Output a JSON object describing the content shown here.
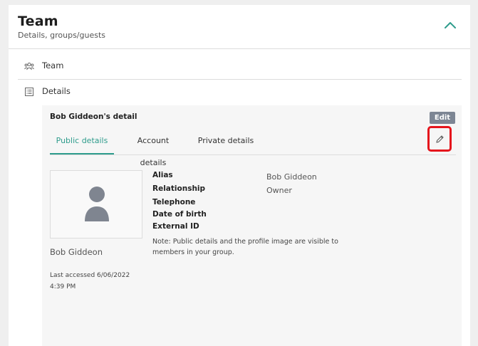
{
  "header": {
    "title": "Team",
    "subtitle": "Details, groups/guests",
    "collapse_icon": "chevron-up-icon",
    "accent_color": "#2e9c8c"
  },
  "sections": {
    "team_label": "Team",
    "details_label": "Details"
  },
  "panel": {
    "title": "Bob Giddeon's detail",
    "edit_label": "Edit",
    "tabs": [
      {
        "label": "Public details",
        "active": true
      },
      {
        "label": "Account details",
        "active": false
      },
      {
        "label": "Private details",
        "active": false
      }
    ],
    "profile": {
      "name": "Bob Giddeon",
      "last_accessed": "Last accessed 6/06/2022 4:39 PM"
    },
    "fields": [
      {
        "label": "Alias",
        "value": "Bob Giddeon"
      },
      {
        "label": "Relationship",
        "value": "Owner"
      },
      {
        "label": "Telephone",
        "value": ""
      },
      {
        "label": "Date of birth",
        "value": ""
      },
      {
        "label": "External ID",
        "value": ""
      }
    ],
    "note": "Note: Public details and the profile image are visible to members in your group.",
    "highlight_color": "#e5141c"
  }
}
